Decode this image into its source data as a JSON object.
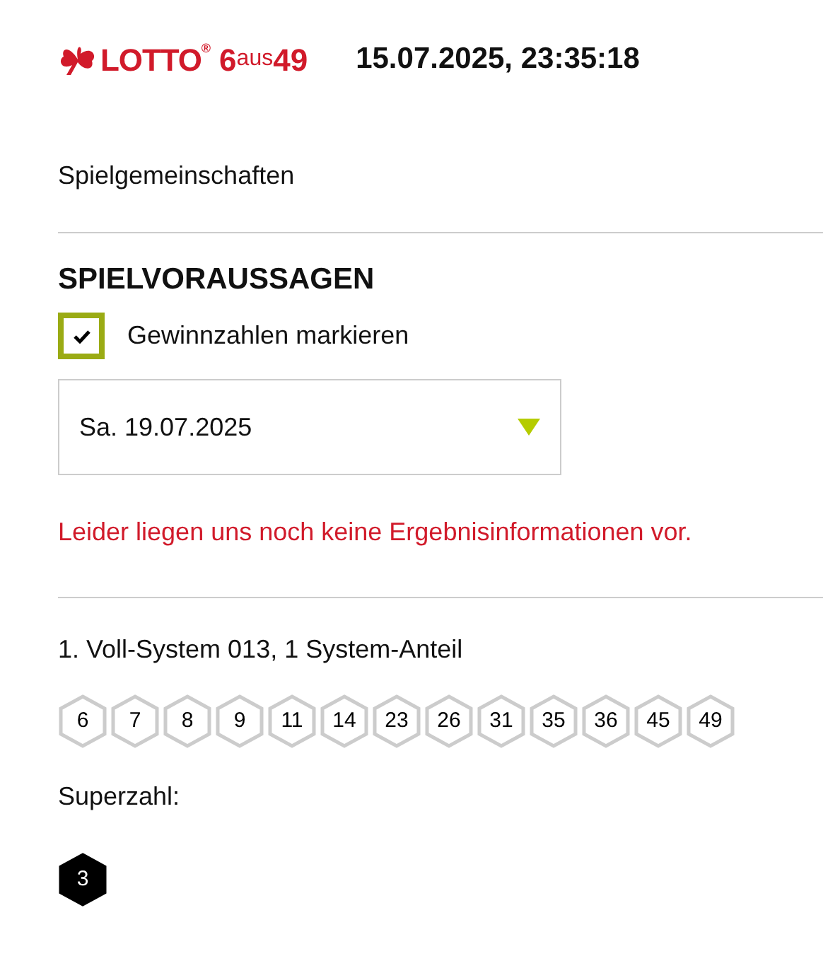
{
  "header": {
    "logo": {
      "brand": "LOTTO",
      "registered": "®",
      "six": "6",
      "aus": "aus",
      "fortynine": "49"
    },
    "datetime": "15.07.2025, 23:35:18"
  },
  "nav_link": "Spielgemeinschaften",
  "section_title": "SPIELVORAUSSAGEN",
  "mark_winners": {
    "label": "Gewinnzahlen markieren",
    "checked": true
  },
  "draw_date": {
    "value": "Sa. 19.07.2025"
  },
  "error_message": "Leider liegen uns noch keine Ergebnisinformationen vor.",
  "ticket": {
    "title": "1. Voll-System 013, 1 System-Anteil",
    "numbers": [
      "6",
      "7",
      "8",
      "9",
      "11",
      "14",
      "23",
      "26",
      "31",
      "35",
      "36",
      "45",
      "49"
    ],
    "superzahl_label": "Superzahl:",
    "superzahl": "3"
  }
}
